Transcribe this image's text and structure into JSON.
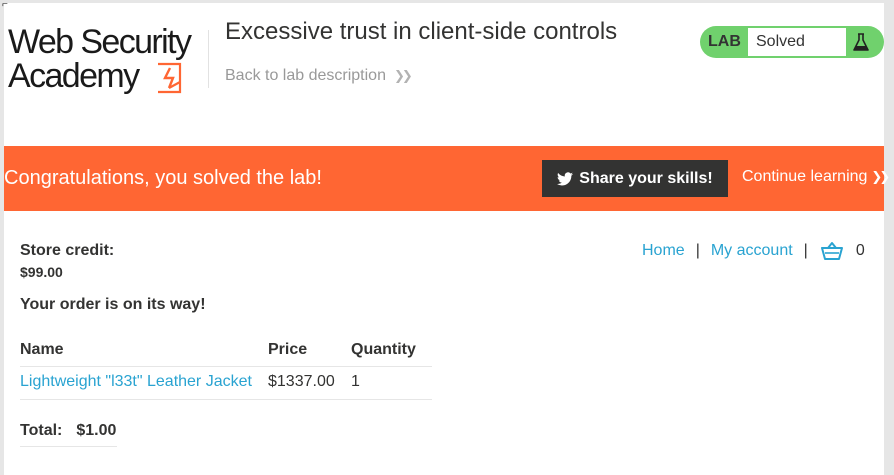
{
  "header": {
    "logo_line1": "Web Security",
    "logo_line2": "Academy",
    "lab_title": "Excessive trust in client-side controls",
    "back_link": "Back to lab description",
    "back_icon": "double-chevron-right-icon",
    "lab_badge": "LAB",
    "lab_status": "Solved",
    "status_icon": "flask-icon",
    "status_color": "#70d16d"
  },
  "banner": {
    "message": "Congratulations, you solved the lab!",
    "share_label": "Share your skills!",
    "share_icon": "twitter-icon",
    "continue_label": "Continue learning",
    "color": "#ff6633"
  },
  "nav": {
    "home": "Home",
    "separator": "|",
    "my_account": "My account",
    "cart_icon": "basket-icon",
    "cart_count": "0"
  },
  "account": {
    "store_credit_label": "Store credit:",
    "store_credit_value": "$99.00",
    "order_message": "Your order is on its way!"
  },
  "cart": {
    "headers": [
      "Name",
      "Price",
      "Quantity"
    ],
    "rows": [
      {
        "name": "Lightweight \"l33t\" Leather Jacket",
        "price": "$1337.00",
        "quantity": "1"
      }
    ],
    "total_label": "Total:",
    "total_value": "$1.00"
  }
}
